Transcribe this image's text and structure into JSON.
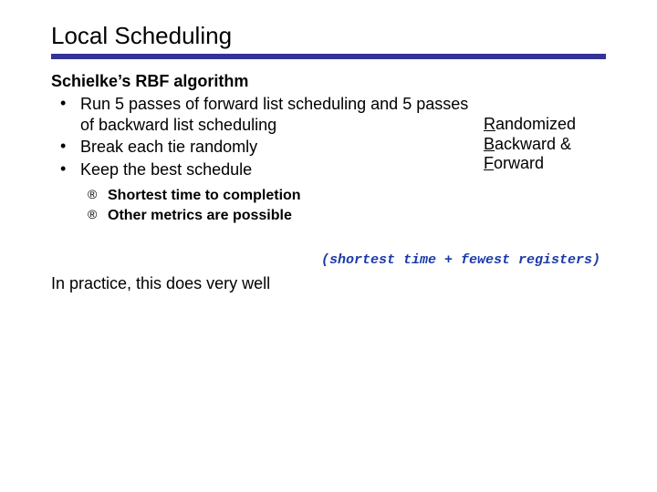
{
  "title": "Local Scheduling",
  "subtitle": "Schielke’s RBF algorithm",
  "bullets": [
    "Run 5 passes of forward list scheduling and 5 passes of backward list scheduling",
    "Break each tie randomly",
    "Keep the best schedule"
  ],
  "sub_bullets": [
    "Shortest time to completion",
    "Other metrics are possible"
  ],
  "side_note": {
    "r": "R",
    "r_rest": "andomized",
    "b": "B",
    "b_rest": "ackward &",
    "f": "F",
    "f_rest": "orward"
  },
  "paren_note": "(shortest time + fewest registers)",
  "closing": "In practice, this does very well"
}
